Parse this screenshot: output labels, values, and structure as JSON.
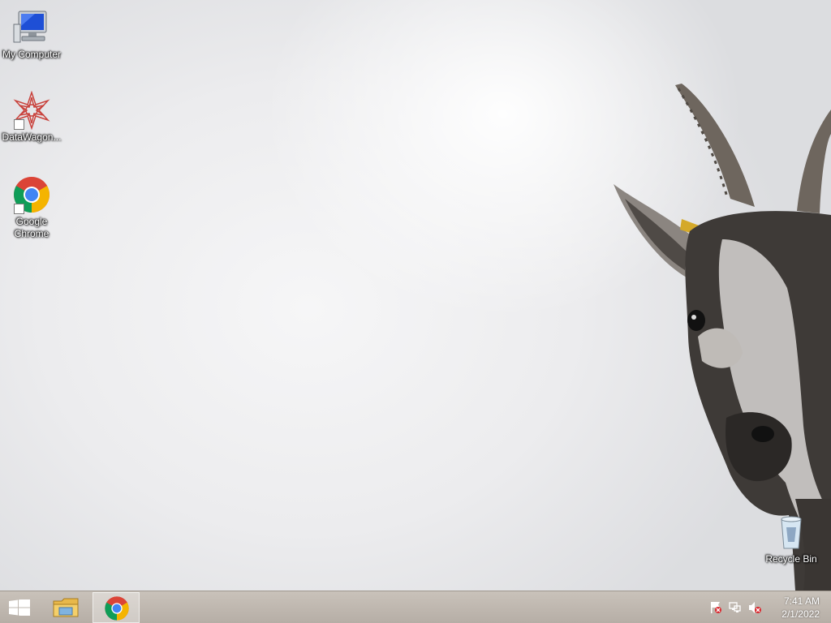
{
  "desktop": {
    "icons": [
      {
        "name": "my-computer",
        "label": "My Computer",
        "icon": "computer-icon"
      },
      {
        "name": "datawagon",
        "label": "DataWagon...",
        "icon": "datawagon-star-icon"
      },
      {
        "name": "google-chrome",
        "label": "Google Chrome",
        "icon": "chrome-icon"
      }
    ],
    "recycle_bin": {
      "label": "Recycle Bin",
      "icon": "recycle-bin-icon"
    },
    "wallpaper": "goat-wallpaper"
  },
  "taskbar": {
    "start_icon": "windows-logo-icon",
    "pinned": [
      {
        "name": "file-explorer",
        "icon": "folder-icon",
        "active": false
      },
      {
        "name": "google-chrome",
        "icon": "chrome-icon",
        "active": true
      }
    ],
    "tray": [
      {
        "name": "action-center",
        "icon": "flag-icon"
      },
      {
        "name": "network",
        "icon": "network-icon"
      },
      {
        "name": "volume",
        "icon": "speaker-muted-icon"
      }
    ],
    "clock": {
      "time": "7:41 AM",
      "date": "2/1/2022"
    }
  },
  "colors": {
    "taskbar": "#bdb5ad",
    "chrome_red": "#db4437",
    "chrome_yellow": "#f4b400",
    "chrome_green": "#0f9d58",
    "chrome_blue": "#4285f4"
  }
}
